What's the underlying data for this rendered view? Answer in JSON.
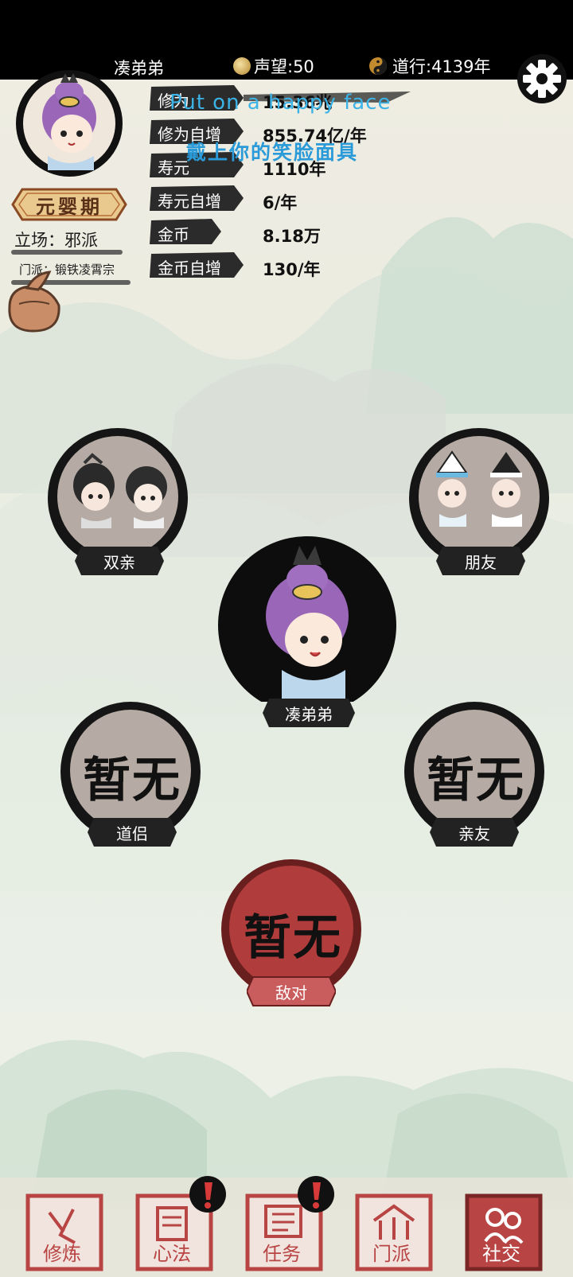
{
  "header": {
    "player_name": "凑弟弟",
    "reputation": "声望:50",
    "daoxing": "道行:4139年"
  },
  "profile": {
    "realm": "元婴期",
    "stance": "立场：邪派",
    "sect": "门派：锻铁凌霄宗"
  },
  "stats": [
    {
      "label": "修为",
      "value": "15.36兆"
    },
    {
      "label": "修为自增",
      "value": "855.74亿/年"
    },
    {
      "label": "寿元",
      "value": "1110年"
    },
    {
      "label": "寿元自增",
      "value": "6/年"
    },
    {
      "label": "金币",
      "value": "8.18万"
    },
    {
      "label": "金币自增",
      "value": "130/年"
    }
  ],
  "overlay": {
    "english": "Put on a happy face",
    "chinese": "戴上你的笑脸面具"
  },
  "relations": {
    "parents": "双亲",
    "friends": "朋友",
    "self": "凑弟弟",
    "partner": "道侣",
    "partner_value": "暂无",
    "kin": "亲友",
    "kin_value": "暂无",
    "enemy": "敌对",
    "enemy_value": "暂无"
  },
  "nav": [
    {
      "label": "修炼"
    },
    {
      "label": "心法"
    },
    {
      "label": "任务"
    },
    {
      "label": "门派"
    },
    {
      "label": "社交"
    }
  ],
  "colors": {
    "stamp_red": "#b84444",
    "enemy_red": "#b03c3c",
    "overlay_blue": "#3bb3e6"
  }
}
